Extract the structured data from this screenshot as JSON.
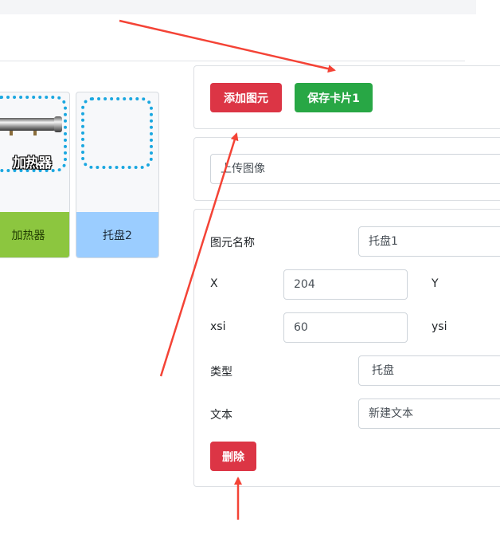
{
  "toolbar": {
    "add_element_label": "添加图元",
    "save_card_label": "保存卡片1"
  },
  "upload": {
    "value": "上传图像"
  },
  "cards": [
    {
      "name": "加热器",
      "image_text": "加热器",
      "color": "#8cc63f"
    },
    {
      "name": "托盘2",
      "color": "#9bcdff"
    }
  ],
  "form": {
    "name_label": "图元名称",
    "name_value": "托盘1",
    "x_label": "X",
    "x_value": "204",
    "y_label": "Y",
    "xsi_label": "xsi",
    "xsi_value": "60",
    "ysi_label": "ysi",
    "type_label": "类型",
    "type_value": "托盘",
    "text_label": "文本",
    "text_value": "新建文本",
    "delete_label": "删除"
  },
  "colors": {
    "danger": "#dc3545",
    "success": "#28a745",
    "arrow": "#f44336",
    "dotted_border": "#1aa7e0"
  }
}
